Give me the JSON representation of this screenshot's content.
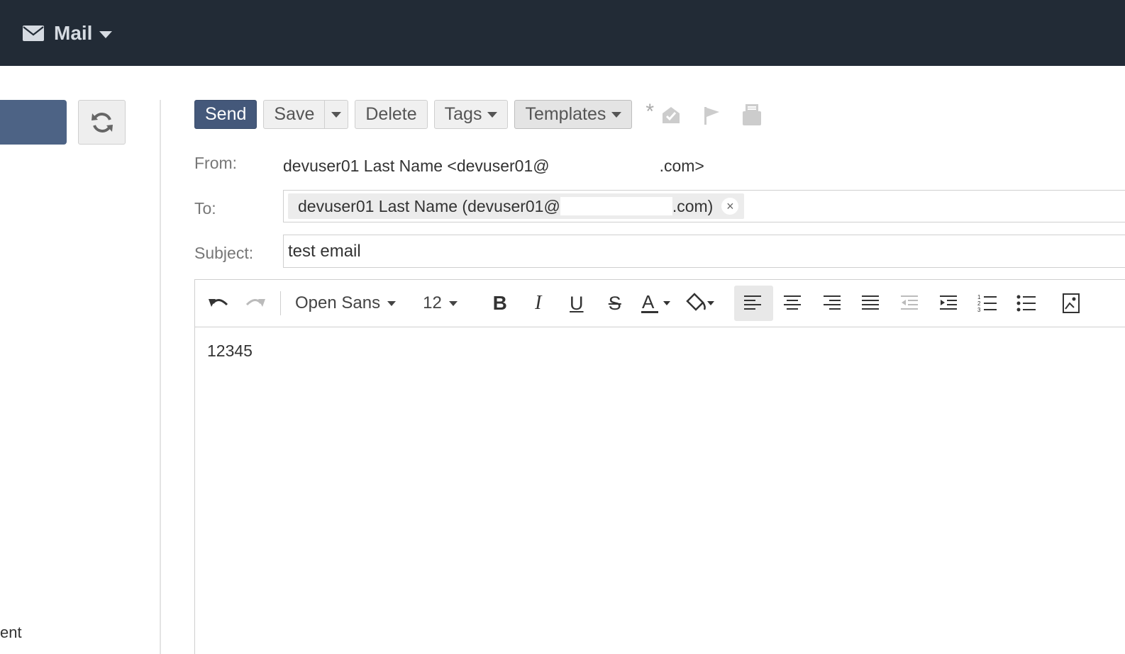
{
  "header": {
    "app_title": "Mail",
    "icon": "envelope-icon"
  },
  "sidebar": {
    "partial_text": "ent"
  },
  "toolbar": {
    "send_label": "Send",
    "save_label": "Save",
    "delete_label": "Delete",
    "tags_label": "Tags",
    "templates_label": "Templates",
    "star": "*"
  },
  "compose": {
    "from_label": "From:",
    "from_value_start": "devuser01 Last Name <devuser01@",
    "from_value_end": ".com>",
    "to_label": "To:",
    "to_chip_start": "devuser01 Last Name (devuser01@",
    "to_chip_end": ".com)",
    "to_chip_remove": "×",
    "subject_label": "Subject:",
    "subject_value": "test email"
  },
  "editor": {
    "font_family": "Open Sans",
    "font_size": "12",
    "body_text": "12345"
  },
  "colors": {
    "topbar": "#222b36",
    "primary": "#44587a"
  }
}
